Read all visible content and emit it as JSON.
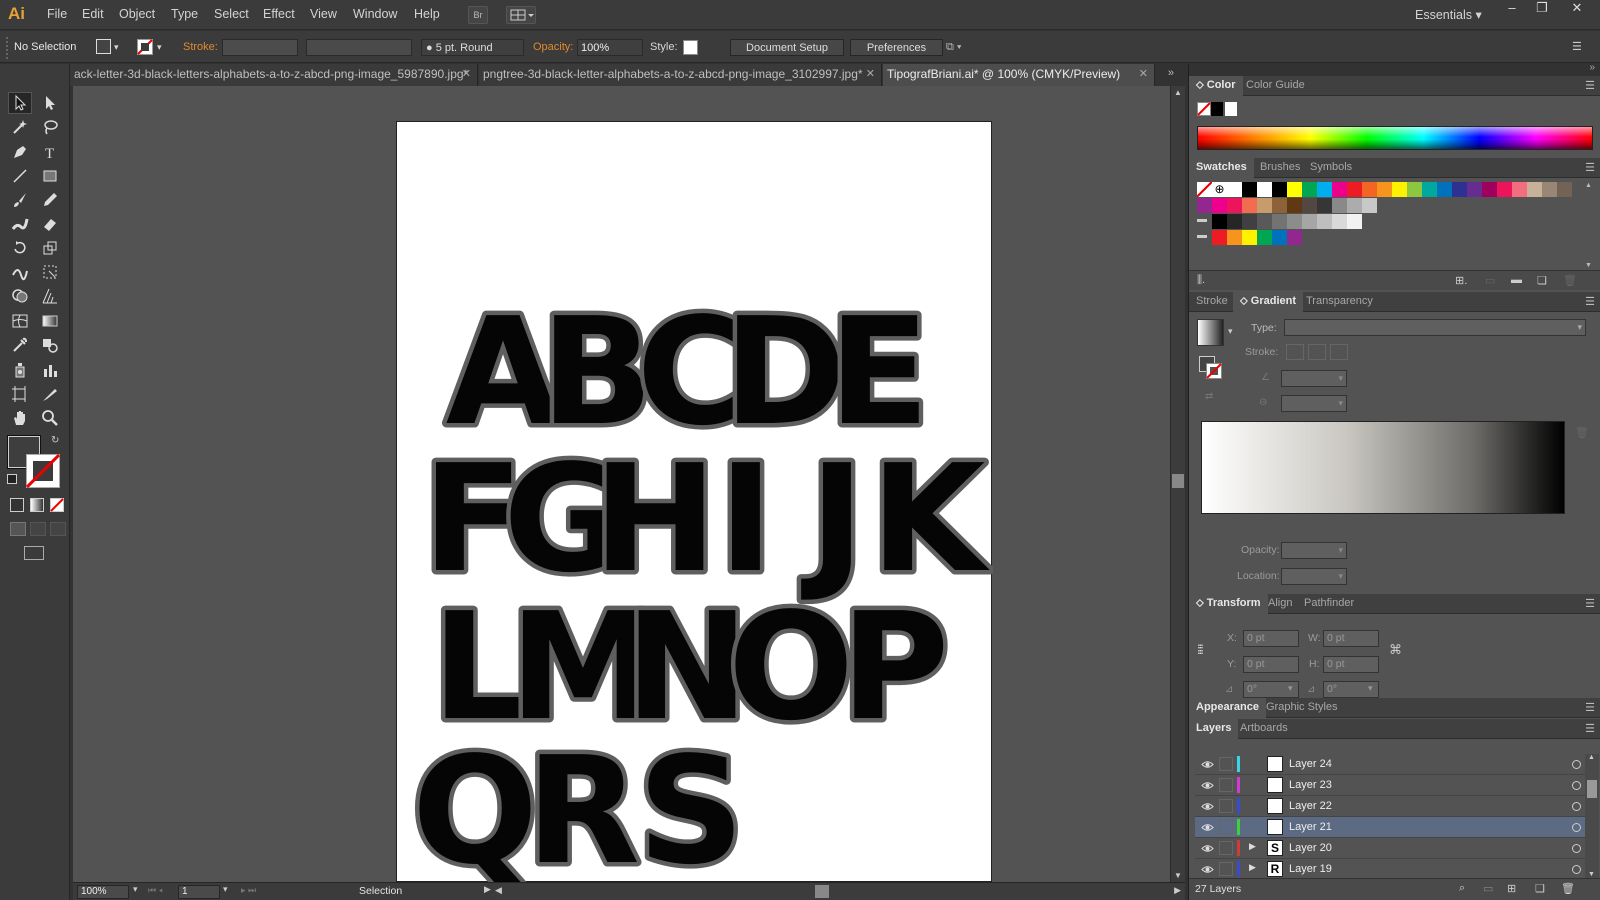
{
  "app": {
    "logo": "Ai"
  },
  "menu": [
    "File",
    "Edit",
    "Object",
    "Type",
    "Select",
    "Effect",
    "View",
    "Window",
    "Help"
  ],
  "menubar_buttons": {
    "bridge": "Br"
  },
  "workspace": {
    "label": "Essentials"
  },
  "control": {
    "selection": "No Selection",
    "stroke_label": "Stroke:",
    "brush": "5 pt. Round",
    "opacity_label": "Opacity:",
    "opacity_value": "100%",
    "style_label": "Style:",
    "document_setup": "Document Setup",
    "preferences": "Preferences"
  },
  "tabs": [
    {
      "label": "ack-letter-3d-black-letters-alphabets-a-to-z-abcd-png-image_5987890.jpg*"
    },
    {
      "label": "pngtree-3d-black-letter-alphabets-a-to-z-abcd-png-image_3102997.jpg*"
    },
    {
      "label": "TipografBriani.ai* @ 100% (CMYK/Preview)"
    }
  ],
  "artboard": {
    "rows": [
      [
        "A",
        "B",
        "C",
        "D",
        "E"
      ],
      [
        "F",
        "G",
        "H",
        "I",
        "J",
        "K"
      ],
      [
        "L",
        "M",
        "N",
        "O",
        "P"
      ],
      [
        "Q",
        "R",
        "S"
      ]
    ]
  },
  "status": {
    "zoom": "100%",
    "page": "1",
    "tool": "Selection"
  },
  "panels": {
    "color": {
      "tabs": [
        "Color",
        "Color Guide"
      ]
    },
    "swatches": {
      "tabs": [
        "Swatches",
        "Brushes",
        "Symbols"
      ]
    },
    "gradient": {
      "tabs": [
        "Stroke",
        "Gradient",
        "Transparency"
      ],
      "type_label": "Type:",
      "stroke_label": "Stroke:",
      "opacity_label": "Opacity:",
      "location_label": "Location:"
    },
    "transform": {
      "tabs": [
        "Transform",
        "Align",
        "Pathfinder"
      ],
      "x_label": "X:",
      "x": "0 pt",
      "y_label": "Y:",
      "y": "0 pt",
      "w_label": "W:",
      "w": "0 pt",
      "h_label": "H:",
      "h": "0 pt",
      "rotate": "0°",
      "shear": "0°"
    },
    "appearance": {
      "tabs": [
        "Appearance",
        "Graphic Styles"
      ]
    },
    "layers": {
      "tabs": [
        "Layers",
        "Artboards"
      ],
      "items": [
        {
          "name": "Layer 24",
          "color": "#3ad4e8",
          "thumb": ""
        },
        {
          "name": "Layer 23",
          "color": "#d23ad2",
          "thumb": ""
        },
        {
          "name": "Layer 22",
          "color": "#3a4ad2",
          "thumb": ""
        },
        {
          "name": "Layer 21",
          "color": "#3ad23a",
          "thumb": ""
        },
        {
          "name": "Layer 20",
          "color": "#d23a3a",
          "thumb": "S"
        },
        {
          "name": "Layer 19",
          "color": "#3a4ad2",
          "thumb": "R"
        }
      ],
      "count": "27 Layers"
    }
  },
  "colors": {
    "accent": "#e6a238",
    "selected_layer": "#5c6a84",
    "swatch_row1": [
      "#ffffff",
      "#000000",
      "#ffff00",
      "#00a651",
      "#00aeef",
      "#ec008c",
      "#ed1c24",
      "#f26522",
      "#f7941d",
      "#fff200",
      "#8dc63f",
      "#00a99d",
      "#0072bc",
      "#2e3192",
      "#662d91",
      "#9e005d",
      "#ed145b",
      "#f26d7d",
      "#c7b299",
      "#998675",
      "#736357",
      "#534741",
      "#c69c6d",
      "#a67c52",
      "#8c6239",
      "#754c24",
      "#603913",
      "#ff0000",
      "#ff7f00",
      "#ffd400",
      "#00a651",
      "#0054a6",
      "#2e3192",
      "#1b1464"
    ],
    "swatch_row2": [
      "#92278f",
      "#ec008c",
      "#ed145b",
      "#f26c4f",
      "#c69c6d",
      "#8c6239",
      "#603913",
      "#534741",
      "#363636",
      "#898989",
      "#acacac",
      "#c8c8c8"
    ],
    "swatch_row3": [
      "#000000",
      "#262626",
      "#404040",
      "#595959",
      "#737373",
      "#8c8c8c",
      "#a6a6a6",
      "#bfbfbf",
      "#d9d9d9",
      "#f2f2f2"
    ],
    "swatch_row4": [
      "#ed1c24",
      "#f7941d",
      "#fff200",
      "#00a651",
      "#0072bc",
      "#92278f"
    ]
  }
}
